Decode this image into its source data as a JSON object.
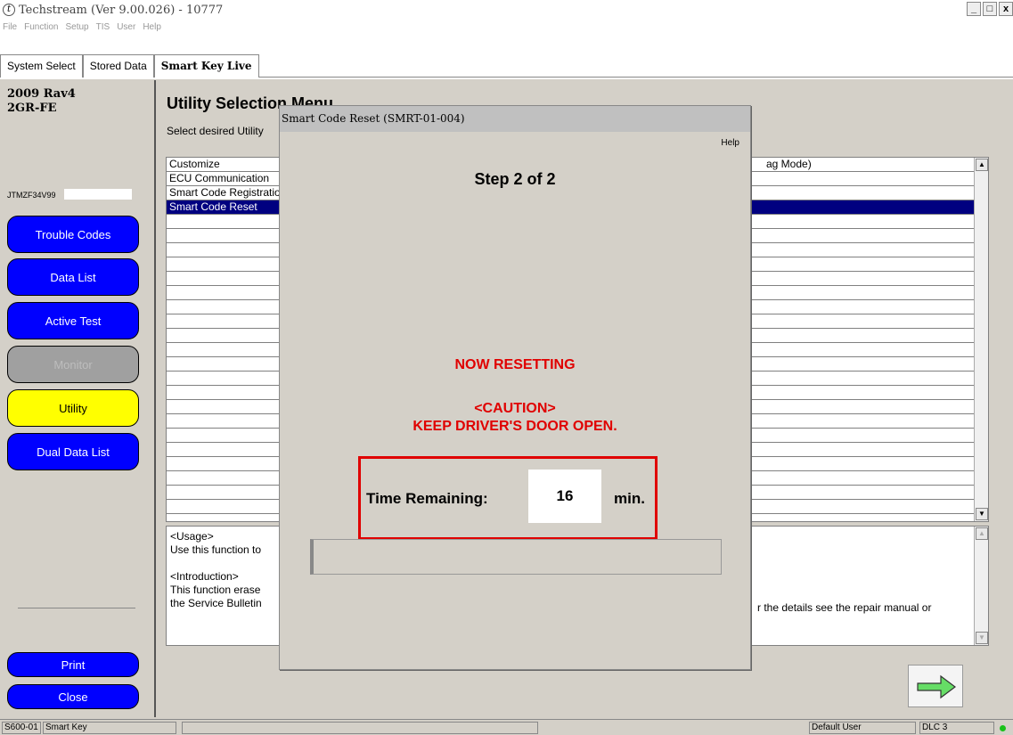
{
  "window": {
    "title": "Techstream (Ver 9.00.026) - 10777",
    "controls": [
      "_",
      "□",
      "x"
    ]
  },
  "menu": [
    "File",
    "Function",
    "Setup",
    "TIS",
    "User",
    "Help"
  ],
  "tabs": [
    {
      "label": "System Select",
      "active": false
    },
    {
      "label": "Stored Data",
      "active": false
    },
    {
      "label": "Smart Key Live",
      "active": true
    }
  ],
  "sidebar": {
    "vehicle_line1": "2009 Rav4",
    "vehicle_line2": "2GR-FE",
    "vin": "JTMZF34V99",
    "buttons": {
      "trouble_codes": "Trouble Codes",
      "data_list": "Data List",
      "active_test": "Active Test",
      "monitor": "Monitor",
      "utility": "Utility",
      "dual_data_list": "Dual Data List",
      "print": "Print",
      "close": "Close"
    }
  },
  "main": {
    "title": "Utility Selection Menu",
    "subtitle": "Select desired Utility",
    "list_items": [
      "Customize",
      "ECU Communication",
      "Smart Code Registration",
      "Smart Code Reset"
    ],
    "list_right_text": "ag Mode)",
    "desc_usage_title": "<Usage>",
    "desc_usage_text": "Use this function to",
    "desc_intro_title": "<Introduction>",
    "desc_intro_line1": "This function erase",
    "desc_intro_line2": "the Service Bulletin",
    "desc_right_text": "r the details see the repair manual or"
  },
  "dialog": {
    "title": "Smart Code Reset (SMRT-01-004)",
    "help": "Help",
    "step": "Step 2 of 2",
    "status": "NOW RESETTING",
    "caution_title": "<CAUTION>",
    "caution_text": "KEEP DRIVER'S DOOR OPEN.",
    "time_label": "Time Remaining:",
    "time_value": "16",
    "time_unit": "min."
  },
  "statusbar": {
    "code": "S600-01",
    "system": "Smart Key",
    "user": "Default User",
    "connection": "DLC 3"
  },
  "colors": {
    "button_blue": "#0000ff",
    "button_selected": "#ffff00",
    "caution_red": "#e00000",
    "selection": "#000080",
    "status_led": "#19c119"
  }
}
